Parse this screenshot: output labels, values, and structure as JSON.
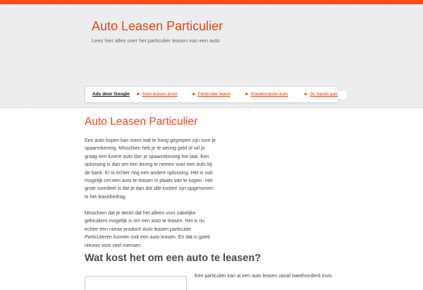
{
  "header": {
    "title": "Auto Leasen Particulier",
    "tagline": "Lees hier alles over het particulier leasen van een auto"
  },
  "ad_bar": {
    "label": "Ads door Google",
    "arrow": "►",
    "links": [
      "Auto leasen prive",
      "Particulier lease",
      "Goedkoopste auto",
      "2e hands auto"
    ]
  },
  "article": {
    "title": "Auto Leasen Particulier",
    "paragraphs": [
      "Een auto kopen kan soms wat te hoog gegrepen zijn voor je spaarrekening. Misschien heb je te weinig geld of wil je graag een luxere auto dan je spaarrekening toe laat. Een oplossing is dan om een lening te nemen voor een auto bij de bank. Er is echter nog een andere oplossing. Het is ook mogelijk om een auto te leasen in plaats van te kopen. Het grote voordeel is dat je dan dat alle kosten zijn opgenomen in het leasebedrag.",
      "Misschien dat je denkt dat het alleen voor zakelijke gebruikers mogelijk is om een auto te leasen. Het is nu echter een nieuw product! Auto leasen particulier. Particulieren kunnen ook een auto leasen. En dat is goed nieuws voor veel mensen."
    ],
    "section_heading": "Wat kost het om een auto te leasen?",
    "section_text": "Een particulier kan al een auto leasen vanaf tweehonderd euro."
  },
  "colors": {
    "accent": "#e8461a",
    "top_bar": "#ff4a12",
    "header_bg": "#ececec",
    "body_text": "#444444"
  }
}
